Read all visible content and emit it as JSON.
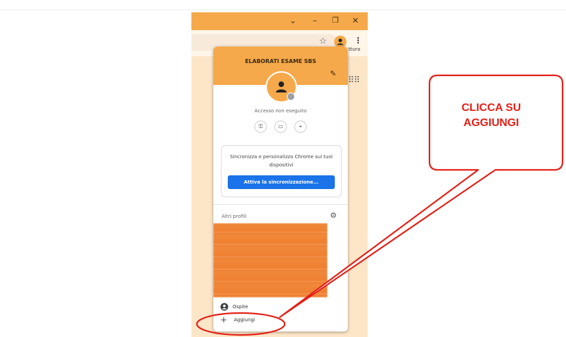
{
  "popup": {
    "title": "ELABORATI ESAME SBS",
    "status": "Accesso non eseguito",
    "sync_message": "Sincronizza e personalizza Chrome sui tuoi dispositivi",
    "sync_button": "Attiva la sincronizzazione...",
    "other_profiles_label": "Altri profili",
    "guest_label": "Ospite",
    "add_label": "Aggiungi"
  },
  "toolbar": {
    "bookmark_fragment": "ttura"
  },
  "annotation": {
    "callout_line1": "CLICCA SU",
    "callout_line2": "AGGIUNGI",
    "color": "#e32017"
  },
  "colors": {
    "theme_orange": "#f5a94a",
    "sync_blue": "#1a73e8"
  }
}
